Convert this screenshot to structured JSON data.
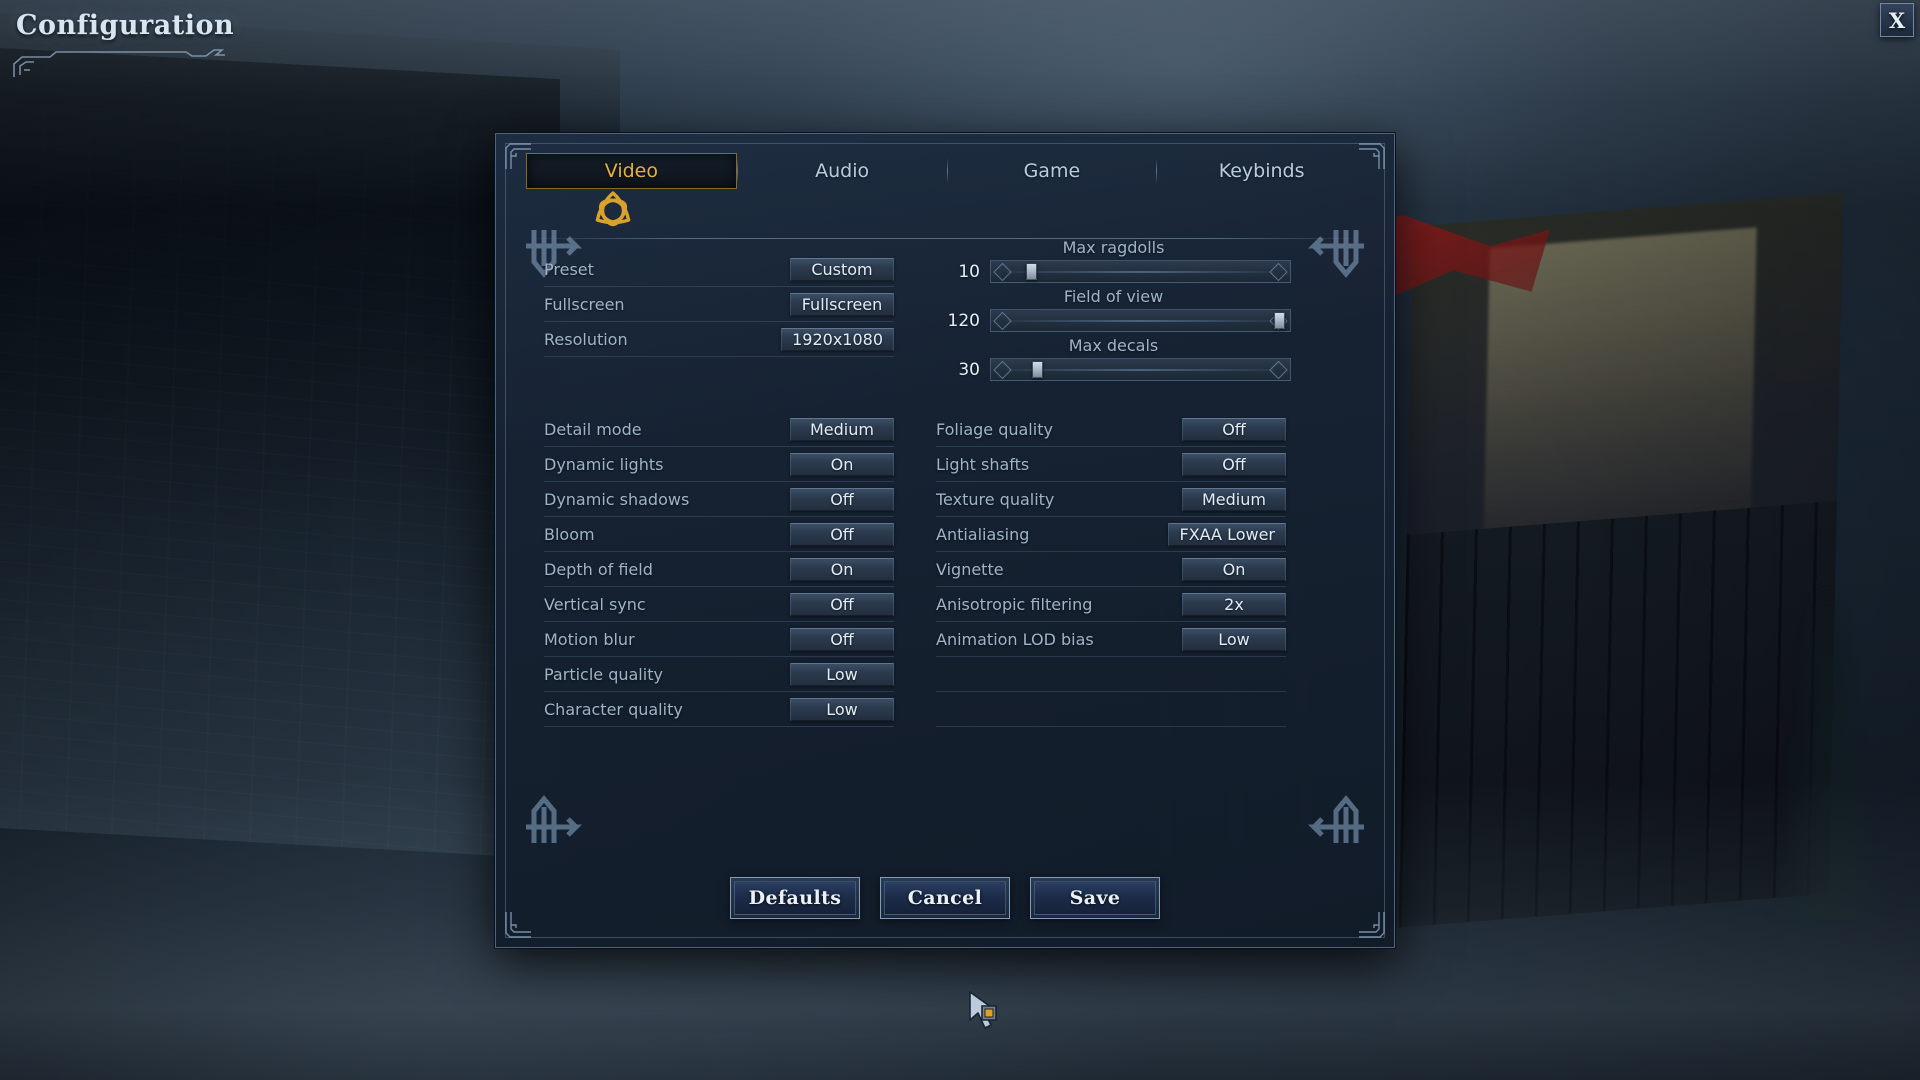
{
  "window": {
    "title": "Configuration",
    "close_label": "X",
    "close_icon": "close-x-icon"
  },
  "tabs": [
    {
      "label": "Video",
      "active": true
    },
    {
      "label": "Audio",
      "active": false
    },
    {
      "label": "Game",
      "active": false
    },
    {
      "label": "Keybinds",
      "active": false
    }
  ],
  "tab_emblem_icon": "triquetra-icon",
  "display_settings": [
    {
      "label": "Preset",
      "value": "Custom"
    },
    {
      "label": "Fullscreen",
      "value": "Fullscreen"
    },
    {
      "label": "Resolution",
      "value": "1920x1080"
    }
  ],
  "sliders": [
    {
      "label": "Max ragdolls",
      "value": "10",
      "percent": 9
    },
    {
      "label": "Field of view",
      "value": "120",
      "percent": 95
    },
    {
      "label": "Max decals",
      "value": "30",
      "percent": 11
    }
  ],
  "graphics_left": [
    {
      "label": "Detail mode",
      "value": "Medium"
    },
    {
      "label": "Dynamic lights",
      "value": "On"
    },
    {
      "label": "Dynamic shadows",
      "value": "Off"
    },
    {
      "label": "Bloom",
      "value": "Off"
    },
    {
      "label": "Depth of field",
      "value": "On"
    },
    {
      "label": "Vertical sync",
      "value": "Off"
    },
    {
      "label": "Motion blur",
      "value": "Off"
    },
    {
      "label": "Particle quality",
      "value": "Low"
    },
    {
      "label": "Character quality",
      "value": "Low"
    }
  ],
  "graphics_right": [
    {
      "label": "Foliage quality",
      "value": "Off"
    },
    {
      "label": "Light shafts",
      "value": "Off"
    },
    {
      "label": "Texture quality",
      "value": "Medium"
    },
    {
      "label": "Antialiasing",
      "value": "FXAA Lower"
    },
    {
      "label": "Vignette",
      "value": "On"
    },
    {
      "label": "Anisotropic filtering",
      "value": "2x"
    },
    {
      "label": "Animation LOD bias",
      "value": "Low"
    }
  ],
  "footer_buttons": [
    {
      "label": "Defaults"
    },
    {
      "label": "Cancel"
    },
    {
      "label": "Save"
    }
  ],
  "colors": {
    "accent_gold": "#e7b23c",
    "panel_border": "#4d6583",
    "label_text": "#9fb4c9",
    "value_text": "#e2ecf6"
  }
}
